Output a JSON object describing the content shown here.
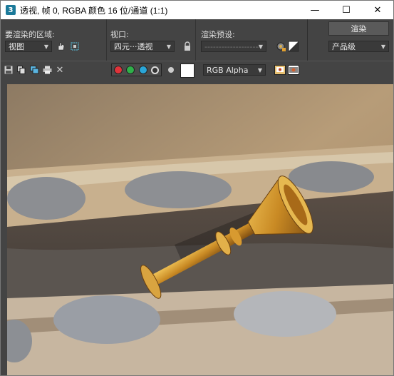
{
  "window": {
    "title": "透视, 帧 0, RGBA 颜色 16 位/通道 (1:1)",
    "app_icon_text": "3",
    "minimize": "—",
    "maximize": "☐",
    "close": "✕"
  },
  "render_panel": {
    "area_label": "要渲染的区域:",
    "area_value": "视图",
    "viewport_label": "视口:",
    "viewport_value": "四元···透视",
    "preset_label": "渲染预设:",
    "preset_value": "--------------------",
    "render_button": "渲染",
    "quality_value": "产品级"
  },
  "toolbar": {
    "channel_value": "RGB Alpha",
    "colors": {
      "red": "#e0333a",
      "green": "#2fb04a",
      "blue": "#2aa6d8",
      "white": "#ffffff"
    }
  }
}
